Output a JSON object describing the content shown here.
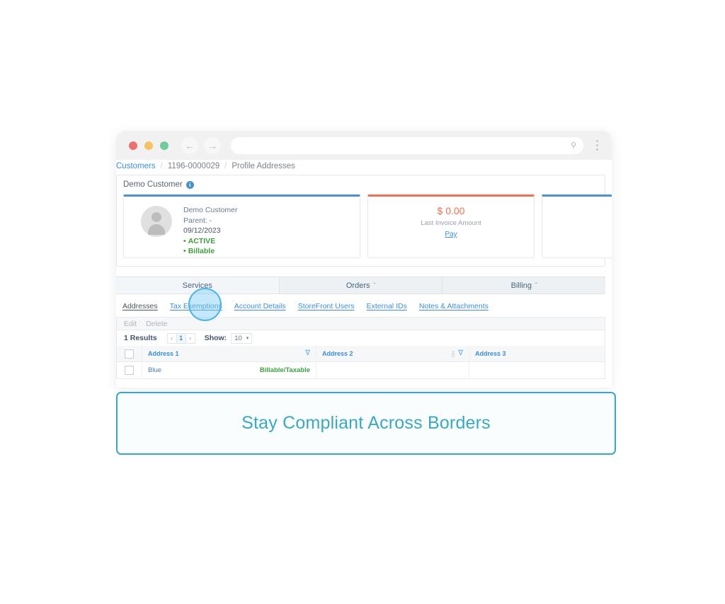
{
  "browser": {
    "url_value": "",
    "url_placeholder": "",
    "back_glyph": "←",
    "forward_glyph": "→",
    "search_icon": "⚲",
    "traffic_lights": [
      "red",
      "yellow",
      "green"
    ]
  },
  "breadcrumb": {
    "root": "Customers",
    "sep1": "/",
    "id": "1196-0000029",
    "sep2": "/",
    "current": "Profile Addresses"
  },
  "panel": {
    "title": "Demo Customer",
    "info_icon": "i"
  },
  "cards": {
    "profile": {
      "name": "Demo Customer",
      "parent": "Parent: -",
      "date": "09/12/2023",
      "status": "ACTIVE",
      "billable": "Billable"
    },
    "invoice": {
      "amount": "$ 0.00",
      "label": "Last Invoice Amount",
      "pay_link": "Pay"
    }
  },
  "main_tabs": [
    {
      "label": "Services",
      "caret": "",
      "active": true
    },
    {
      "label": "Orders",
      "caret": "ˇ",
      "active": false
    },
    {
      "label": "Billing",
      "caret": "ˇ",
      "active": false
    }
  ],
  "sub_tabs": [
    {
      "label": "Addresses"
    },
    {
      "label": "Tax Exemptions"
    },
    {
      "label": "Account Details"
    },
    {
      "label": "StoreFront Users"
    },
    {
      "label": "External IDs"
    },
    {
      "label": "Notes & Attachments"
    }
  ],
  "action_bar": {
    "edit": "Edit",
    "delete": "Delete"
  },
  "pager": {
    "results": "1 Results",
    "prev": "‹",
    "page": "1",
    "next": "›",
    "show_label": "Show:",
    "show_value": "10",
    "caret": "▾"
  },
  "table": {
    "columns": [
      "Address 1",
      "Address 2",
      "Address 3"
    ],
    "filter_icon": "∇",
    "rows": [
      {
        "address1": "Blue",
        "address1_tag": "Billable/Taxable",
        "address2": "",
        "address3": ""
      }
    ]
  },
  "banner": {
    "text": "Stay Compliant Across Borders"
  },
  "colors": {
    "link_blue": "#3b8fd4",
    "accent_orange": "#ef6f4e",
    "status_green": "#3f9e3f",
    "banner_teal": "#37a8bf",
    "card_top_blue": "#4a90d9"
  }
}
